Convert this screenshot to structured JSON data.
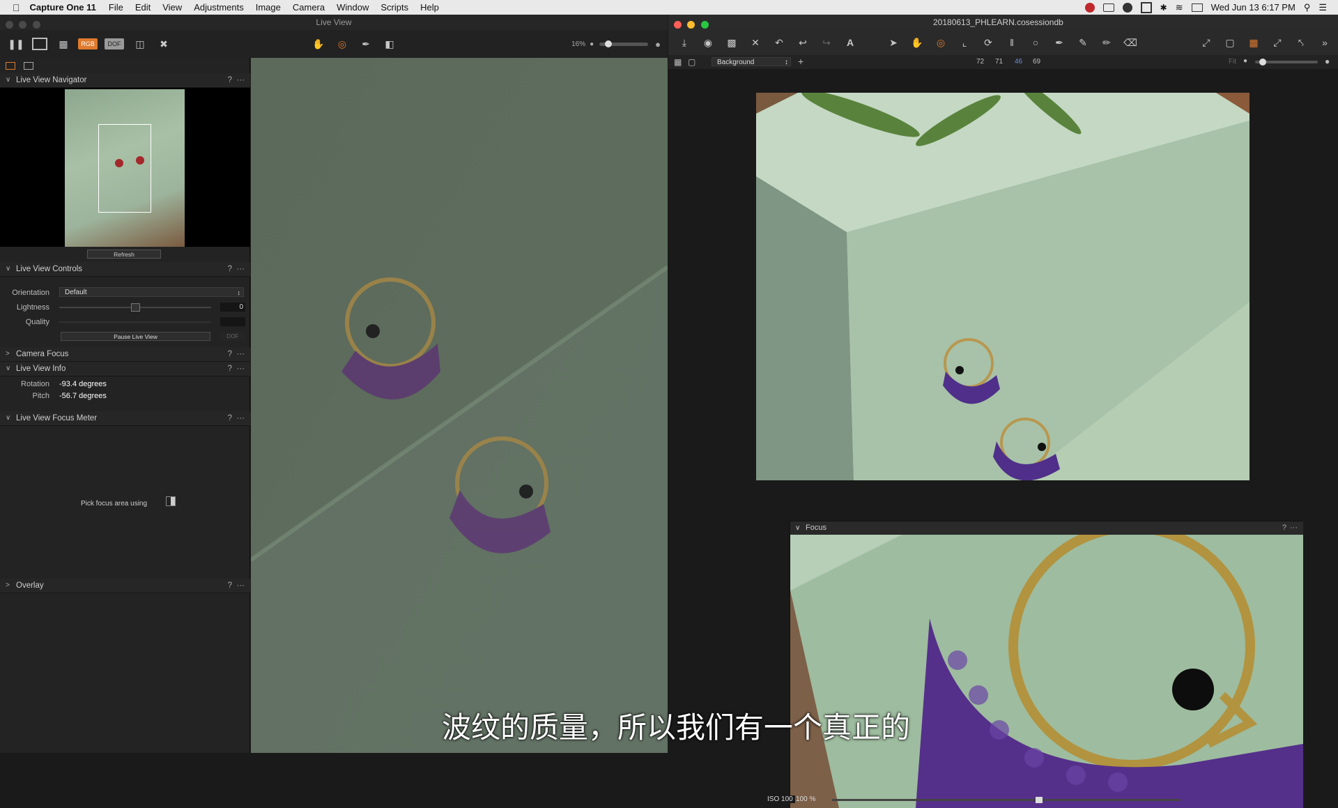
{
  "menubar": {
    "app": "Capture One 11",
    "items": [
      "File",
      "Edit",
      "View",
      "Adjustments",
      "Image",
      "Camera",
      "Window",
      "Scripts",
      "Help"
    ],
    "clock": "Wed Jun 13  6:17 PM"
  },
  "live_view": {
    "title": "Live View",
    "toolbar": {
      "rgb": "RGB",
      "dof": "DOF",
      "zoom": "16%"
    },
    "navigator": {
      "title": "Live View Navigator",
      "refresh": "Refresh"
    },
    "controls": {
      "title": "Live View Controls",
      "orientation_label": "Orientation",
      "orientation_value": "Default",
      "lightness_label": "Lightness",
      "lightness_value": "0",
      "lightness_level": 0.5,
      "quality_label": "Quality",
      "pause_button": "Pause Live View",
      "dof_button": "DOF"
    },
    "camera_focus": {
      "title": "Camera Focus"
    },
    "info": {
      "title": "Live View Info",
      "rotation_label": "Rotation",
      "rotation_value": "-93.4 degrees",
      "pitch_label": "Pitch",
      "pitch_value": "-56.7 degrees"
    },
    "focus_meter": {
      "title": "Live View Focus Meter",
      "hint": "Pick focus area using"
    },
    "overlay": {
      "title": "Overlay"
    },
    "section_help": "?",
    "section_more": "···"
  },
  "capture_one": {
    "session_title": "20180613_PHLEARN.cosessiondb",
    "layer": "Background",
    "readout": [
      "72",
      "71",
      "46",
      "69"
    ],
    "fit_label": "Fit",
    "focus_tool": {
      "title": "Focus",
      "iso": "ISO 100",
      "zoom": "100 %"
    }
  },
  "subtitle": "波纹的质量，所以我们有一个真正的",
  "colors": {
    "menubar": "#e9e9ea",
    "rgb_pill": "#e07a2e",
    "accent_red": "#fe5f57",
    "accent_yellow": "#febc2e",
    "accent_green": "#28c840"
  }
}
